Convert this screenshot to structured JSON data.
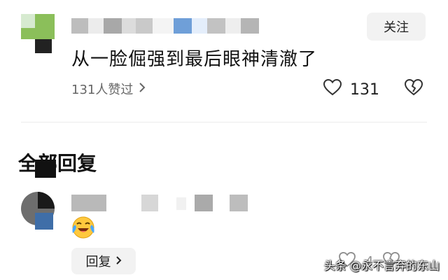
{
  "comment": {
    "follow_label": "关注",
    "text": "从一脸倔强到最后眼神清澈了",
    "likes_summary": "131人赞过",
    "like_count": "131",
    "icons": {
      "like": "heart-outline-icon",
      "dislike": "broken-heart-icon",
      "arrow": "chevron-right-icon"
    }
  },
  "section_title": "全部回复",
  "reply": {
    "emoji": "crying-laughing-emoji",
    "reply_label": "回复",
    "like_count": "4"
  },
  "watermark": "头条 @永不言弃的东山",
  "colors": {
    "background": "#ffffff",
    "button_bg": "#f2f2f2",
    "divider": "#ececec",
    "muted_text": "#666666"
  }
}
